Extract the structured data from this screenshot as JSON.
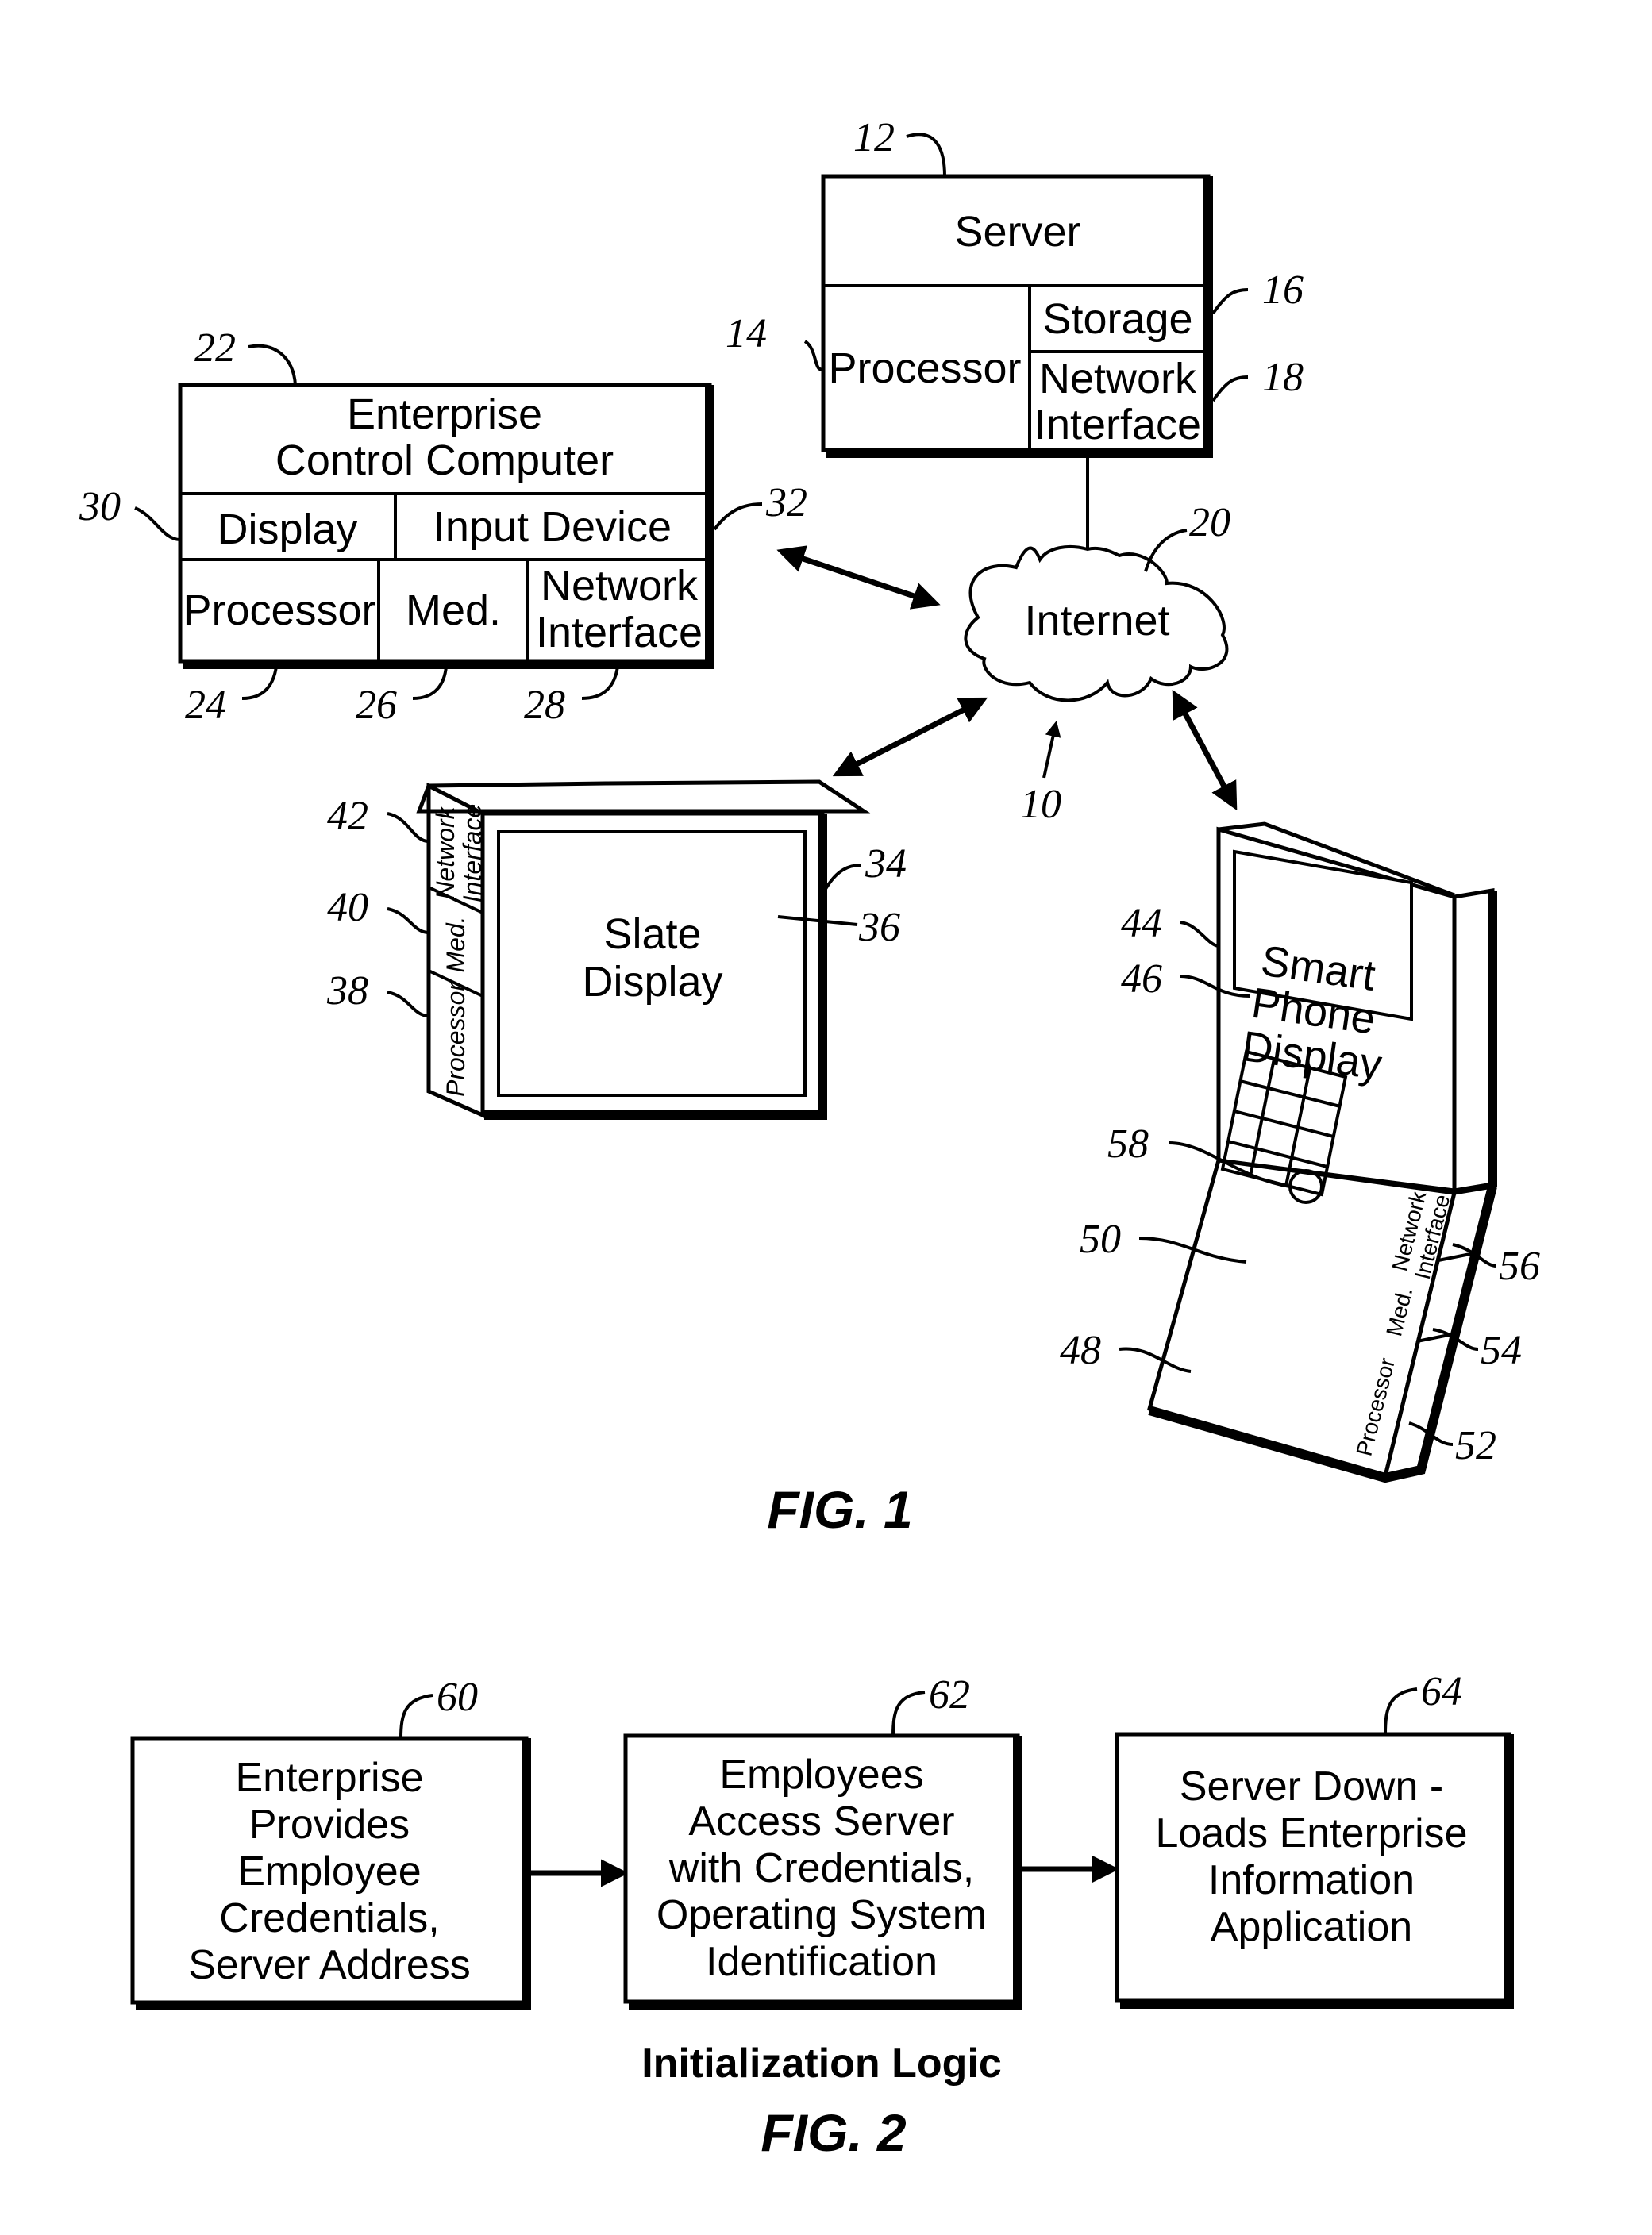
{
  "fig1": {
    "caption": "FIG. 1",
    "system_ref": "10",
    "server": {
      "ref": "12",
      "title": "Server",
      "processor": {
        "label": "Processor",
        "ref": "14"
      },
      "storage": {
        "label": "Storage",
        "ref": "16"
      },
      "network_interface": {
        "line1": "Network",
        "line2": "Interface",
        "ref": "18"
      }
    },
    "internet": {
      "label": "Internet",
      "ref": "20"
    },
    "enterprise_computer": {
      "ref": "22",
      "title_line1": "Enterprise",
      "title_line2": "Control Computer",
      "display": {
        "label": "Display",
        "ref": "30"
      },
      "input_device": {
        "label": "Input Device",
        "ref": "32"
      },
      "processor": {
        "label": "Processor",
        "ref": "24"
      },
      "medium": {
        "label": "Med.",
        "ref": "26"
      },
      "network_interface": {
        "line1": "Network",
        "line2": "Interface",
        "ref": "28"
      }
    },
    "slate": {
      "ref": "34",
      "display_line1": "Slate",
      "display_line2": "Display",
      "display_ref": "36",
      "processor": {
        "label": "Processor",
        "ref": "38"
      },
      "medium": {
        "label": "Med.",
        "ref": "40"
      },
      "network_interface": {
        "line1": "Network",
        "line2": "Interface",
        "ref": "42"
      }
    },
    "smartphone": {
      "ref": "44",
      "display_line1": "Smart",
      "display_line2": "Phone",
      "display_line3": "Display",
      "display_ref": "46",
      "base_ref": "48",
      "keypad_ref": "50",
      "button_ref": "58",
      "processor": {
        "label": "Processor",
        "ref": "52"
      },
      "medium": {
        "label": "Med.",
        "ref": "54"
      },
      "network_interface": {
        "line1": "Network",
        "line2": "Interface",
        "ref": "56"
      }
    }
  },
  "fig2": {
    "caption": "FIG. 2",
    "title": "Initialization Logic",
    "steps": [
      {
        "ref": "60",
        "lines": [
          "Enterprise",
          "Provides",
          "Employee",
          "Credentials,",
          "Server Address"
        ]
      },
      {
        "ref": "62",
        "lines": [
          "Employees",
          "Access Server",
          "with Credentials,",
          "Operating System",
          "Identification"
        ]
      },
      {
        "ref": "64",
        "lines": [
          "Server Down -",
          "Loads Enterprise",
          "Information",
          "Application"
        ]
      }
    ]
  }
}
